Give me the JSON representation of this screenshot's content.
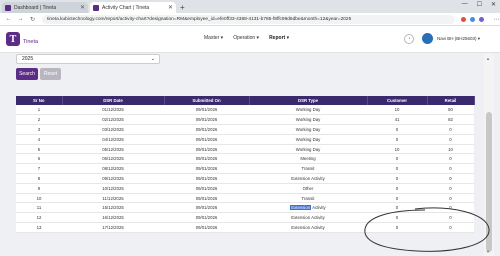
{
  "browser": {
    "tabs": [
      {
        "title": "Dashboard | Tineta",
        "active": false
      },
      {
        "title": "Activity Chart | Tineta",
        "active": true
      }
    ],
    "new_tab": "+",
    "url": "tineta.kubictechnology.com/report/activity-chart?designation=RM&employee_id=efe0ff33-4388-4131-b785-f8ffc99d6dbe&month=12&year=2025"
  },
  "app": {
    "logo_text": "Tineta",
    "nav": [
      {
        "label": "Master",
        "caret": "▾"
      },
      {
        "label": "Operation",
        "caret": "▾"
      },
      {
        "label": "Report",
        "caret": "▾"
      }
    ],
    "user_name": "Navi BH (BH25603)",
    "user_caret": "▾"
  },
  "filters": {
    "year_value": "2025",
    "search_label": "Search",
    "reset_label": "Reset"
  },
  "table": {
    "headers": [
      "Sr No",
      "DSR Date",
      "Submitted On",
      "DSR Type",
      "Customer",
      "Retail"
    ],
    "rows": [
      [
        "1",
        "01/12/2025",
        "09/01/2026",
        "Working Day",
        "10",
        "50"
      ],
      [
        "2",
        "02/12/2025",
        "09/01/2026",
        "Working Day",
        "41",
        "82"
      ],
      [
        "3",
        "03/12/2025",
        "09/01/2026",
        "Working Day",
        "0",
        "0"
      ],
      [
        "4",
        "04/12/2025",
        "09/01/2026",
        "Working Day",
        "0",
        "0"
      ],
      [
        "5",
        "05/12/2025",
        "09/01/2026",
        "Working Day",
        "10",
        "10"
      ],
      [
        "6",
        "06/12/2025",
        "09/01/2026",
        "Meeting",
        "0",
        "0"
      ],
      [
        "7",
        "08/12/2025",
        "09/01/2026",
        "Transit",
        "0",
        "0"
      ],
      [
        "8",
        "09/12/2025",
        "09/01/2026",
        "Extension Activity",
        "0",
        "0"
      ],
      [
        "9",
        "10/12/2025",
        "09/01/2026",
        "Other",
        "0",
        "0"
      ],
      [
        "10",
        "11/12/2025",
        "09/01/2026",
        "Transit",
        "0",
        "0"
      ],
      [
        "11",
        "15/12/2025",
        "09/01/2026",
        "Extension Activity",
        "0",
        "0"
      ],
      [
        "12",
        "16/12/2025",
        "09/01/2026",
        "Extension Activity",
        "0",
        "0"
      ],
      [
        "13",
        "17/12/2025",
        "09/01/2026",
        "Extension Activity",
        "0",
        "0"
      ]
    ]
  },
  "colors": {
    "brand": "#5b2d86",
    "table_header": "#3a2a6d",
    "highlight": "#3a6fd8"
  }
}
